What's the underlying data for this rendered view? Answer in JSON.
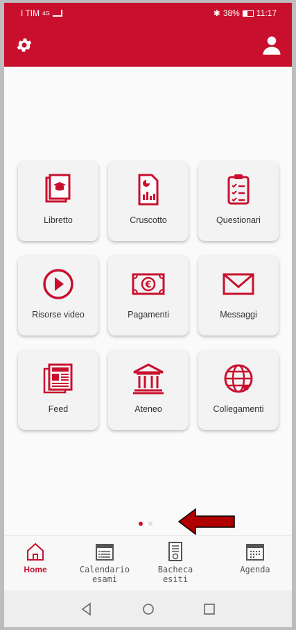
{
  "status_bar": {
    "carrier": "I TIM",
    "network": "4G",
    "battery": "38%",
    "time": "11:17"
  },
  "app_bar": {
    "settings_icon": "gear-icon",
    "profile_icon": "user-icon"
  },
  "tiles": [
    {
      "label": "Libretto",
      "icon": "graduation-book-icon"
    },
    {
      "label": "Cruscotto",
      "icon": "report-chart-icon"
    },
    {
      "label": "Questionari",
      "icon": "clipboard-checklist-icon"
    },
    {
      "label": "Risorse video",
      "icon": "play-circle-icon"
    },
    {
      "label": "Pagamenti",
      "icon": "euro-banknote-icon"
    },
    {
      "label": "Messaggi",
      "icon": "envelope-icon"
    },
    {
      "label": "Feed",
      "icon": "newspaper-icon"
    },
    {
      "label": "Ateneo",
      "icon": "university-building-icon"
    },
    {
      "label": "Collegamenti",
      "icon": "globe-network-icon"
    }
  ],
  "pager": {
    "pages": 2,
    "current": 1
  },
  "bottom_nav": [
    {
      "label": "Home",
      "icon": "home-icon",
      "active": true
    },
    {
      "label": "Calendario esami",
      "icon": "calendar-list-icon",
      "active": false
    },
    {
      "label": "Bacheca esiti",
      "icon": "results-board-icon",
      "active": false
    },
    {
      "label": "Agenda",
      "icon": "calendar-grid-icon",
      "active": false
    }
  ],
  "colors": {
    "brand": "#c8102e",
    "tile_bg": "#f3f3f3",
    "annotation_arrow": "#b00000"
  }
}
